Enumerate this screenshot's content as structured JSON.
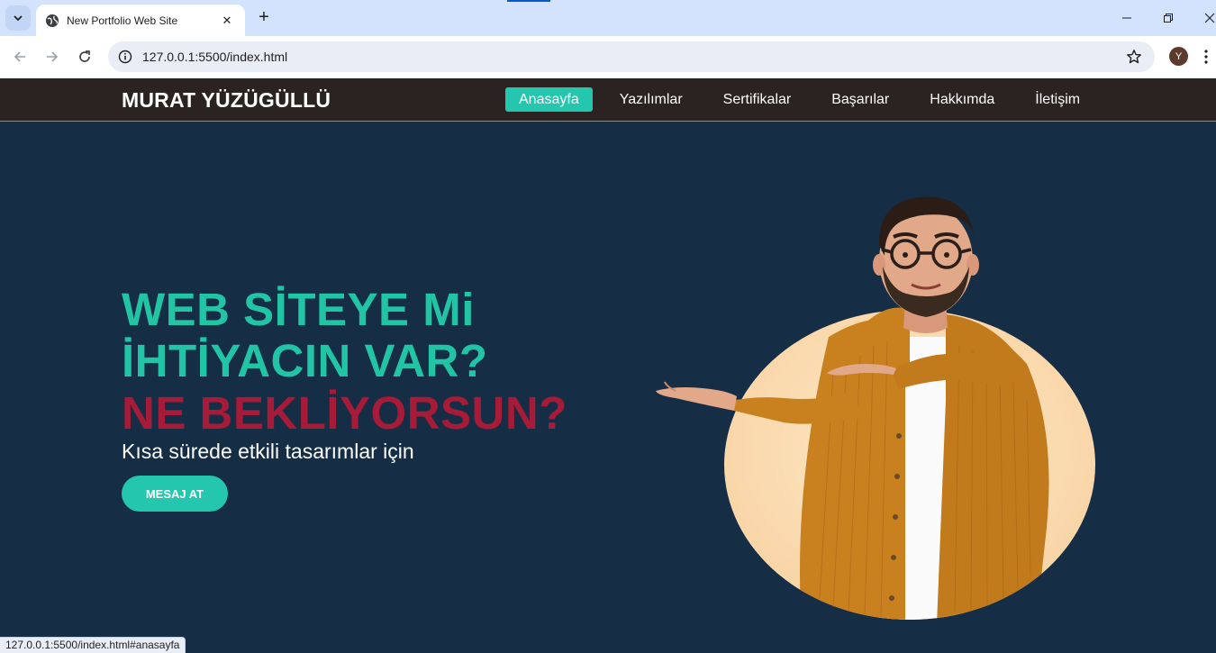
{
  "browser": {
    "tab_title": "New Portfolio Web Site",
    "url": "127.0.0.1:5500/index.html",
    "profile_initial": "Y",
    "status_url": "127.0.0.1:5500/index.html#anasayfa"
  },
  "site": {
    "brand": "MURAT YÜZÜGÜLLÜ",
    "menu": [
      {
        "label": "Anasayfa",
        "active": true
      },
      {
        "label": "Yazılımlar",
        "active": false
      },
      {
        "label": "Sertifikalar",
        "active": false
      },
      {
        "label": "Başarılar",
        "active": false
      },
      {
        "label": "Hakkımda",
        "active": false
      },
      {
        "label": "İletişim",
        "active": false
      }
    ]
  },
  "hero": {
    "line1": "WEB SİTEYE Mi",
    "line2": "İHTİYACIN VAR?",
    "line3": "NE BEKLİYORSUN?",
    "subtitle": "Kısa sürede etkili tasarımlar için",
    "cta": "MESAJ AT"
  },
  "colors": {
    "accent": "#24c7ae",
    "headline_red": "#a61b37",
    "background": "#152d45",
    "navbar": "#2b2222"
  }
}
